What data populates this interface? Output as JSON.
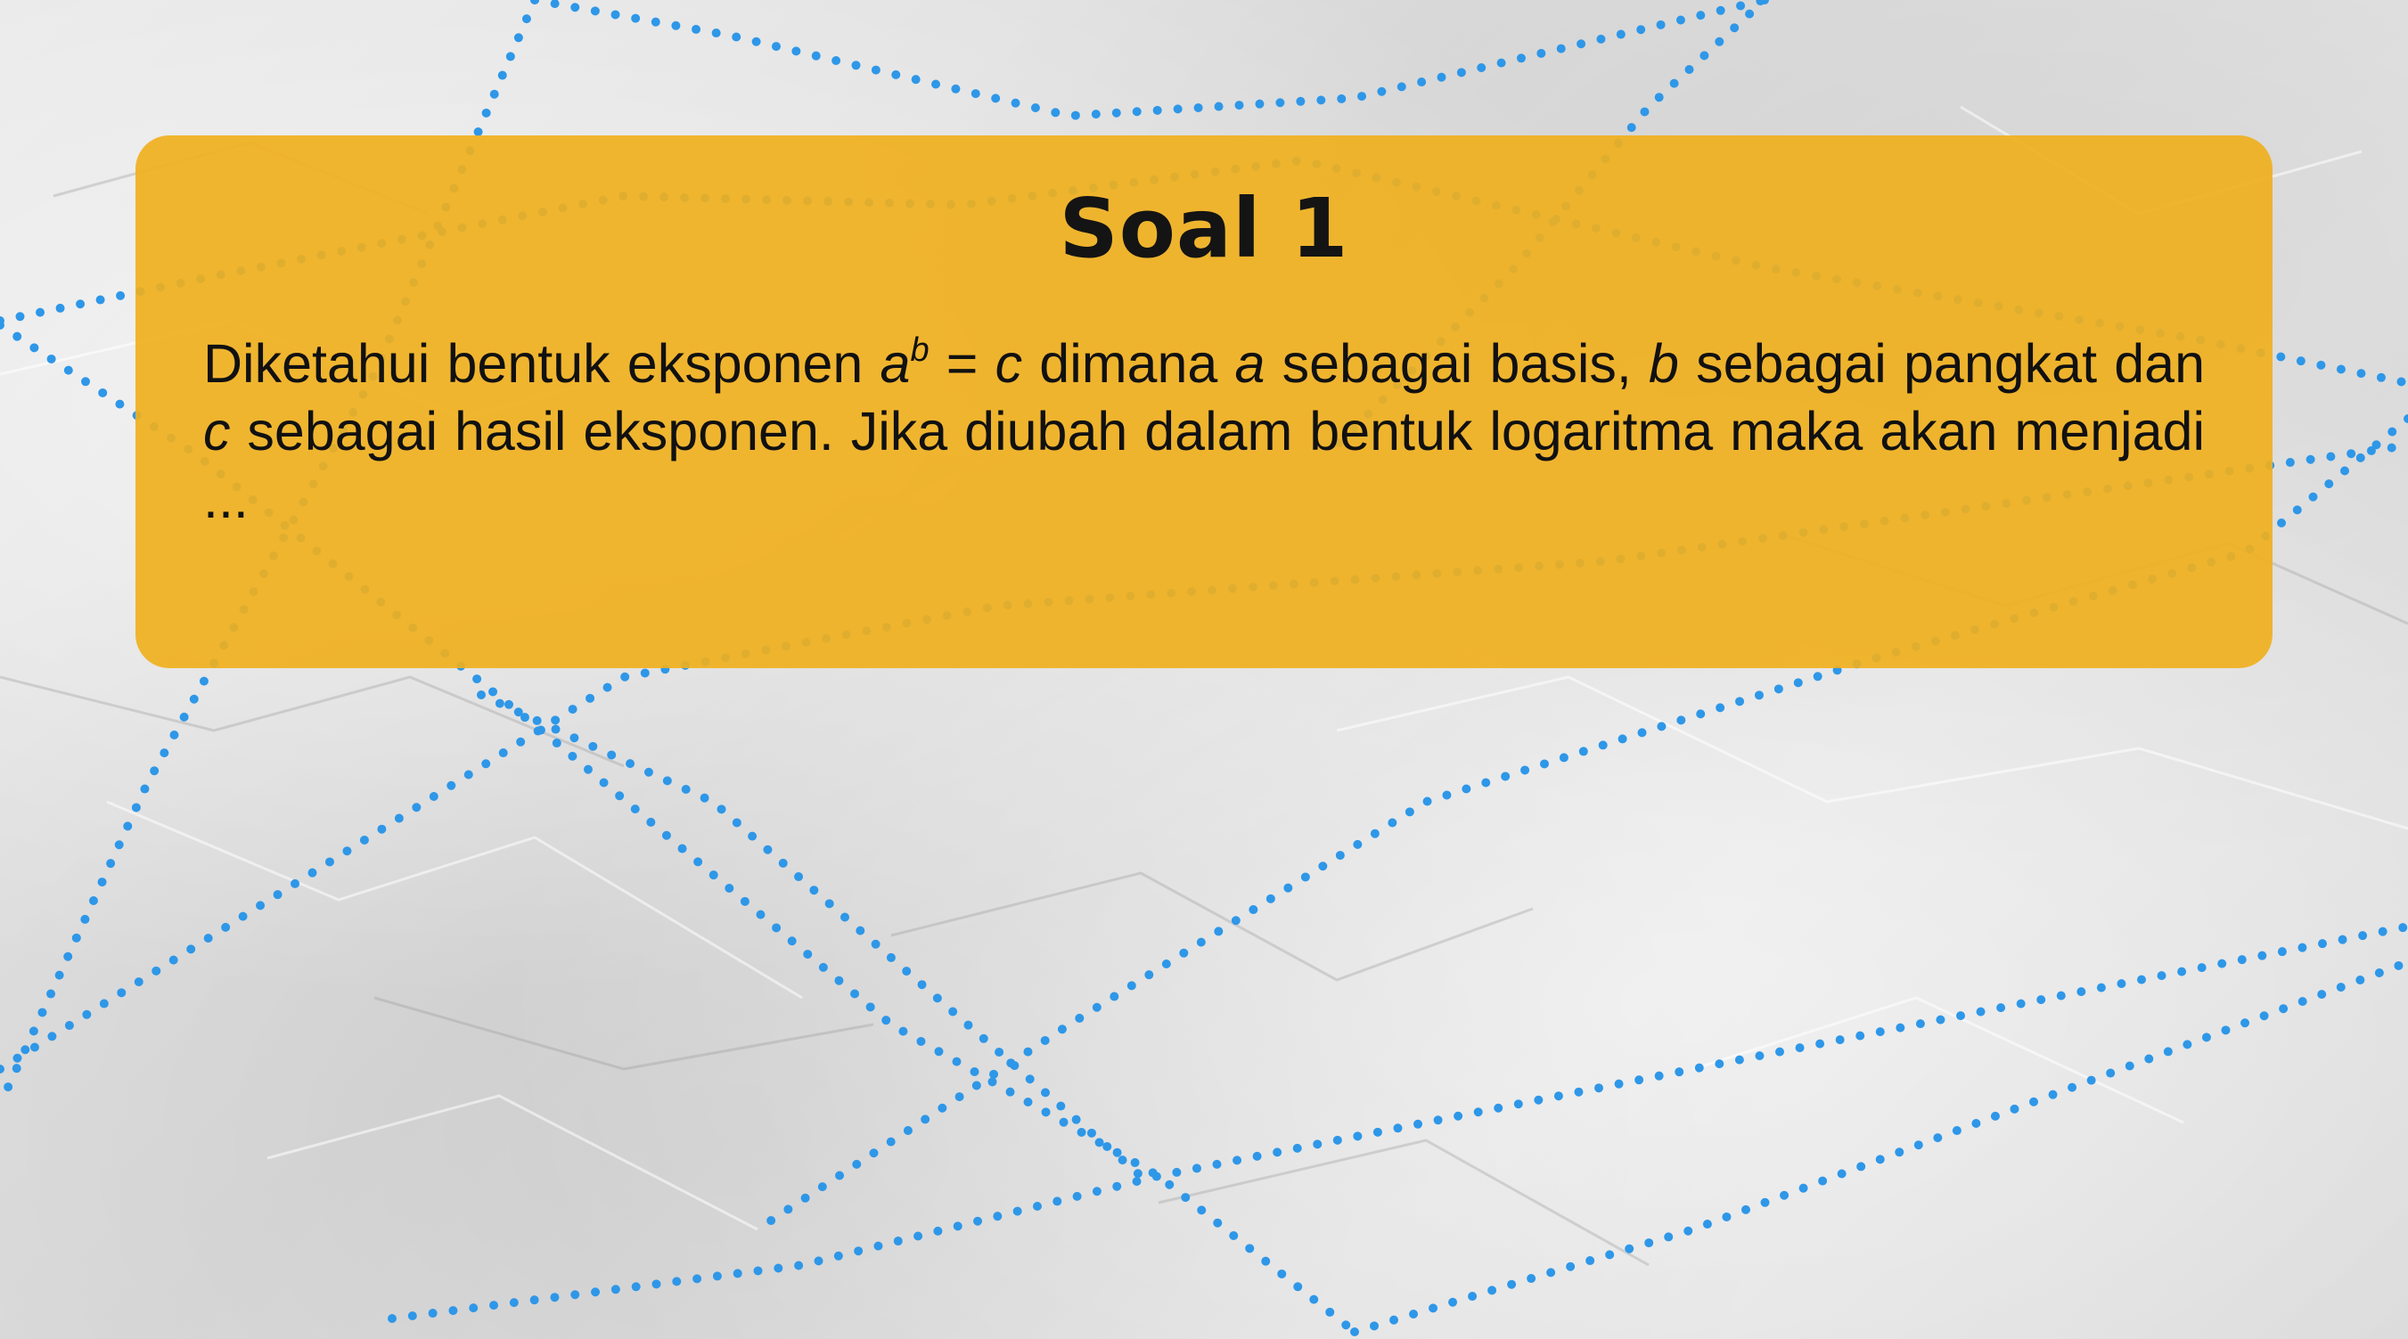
{
  "slide": {
    "title": "Soal 1",
    "question": {
      "intro": "Diketahui bentuk eksponen ",
      "base_var": "a",
      "exp_var": "b",
      "equals": " = ",
      "result_var": "c",
      "part2": " dimana ",
      "var_a": "a",
      "part3": " sebagai basis, ",
      "var_b": "b",
      "part4": " sebagai pangkat dan ",
      "var_c": "c",
      "part5": " sebagai hasil eksponen. Jika diubah dalam bentuk logaritma maka akan menjadi ..."
    }
  },
  "colors": {
    "card": "#F0B01E",
    "dotted_lines": "#2E97E8",
    "background": "#E3E3E3"
  }
}
